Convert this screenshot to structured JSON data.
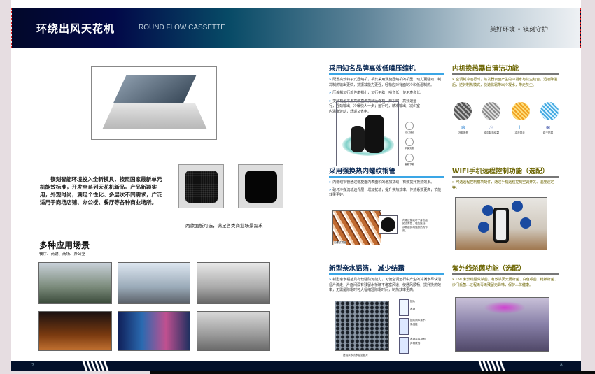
{
  "header": {
    "title": "环绕出风天花机",
    "subtitle": "ROUND FLOW CASSETTE",
    "slogan": "美好环境 • 镁刻守护"
  },
  "left": {
    "intro": "镁刻智能环境投入全新模具，按照国家最新单元机能效标准，开发全系列天花机新品。产品新颖实用，外观时尚，满足个性化、多层次不同需求，广泛适用于商场店铺、办公楼、餐厅等各种商业场所。",
    "panel_caption": "两款面板可选，满足各类商业场景需求",
    "scenes_title": "多种应用场景",
    "scenes_subtitle": "餐厅、商铺、商场、办公室",
    "page_number": "7"
  },
  "right": {
    "page_number": "8",
    "compressor": {
      "title": "采用知名品牌高效低噪压缩机",
      "p1": "配置高效转子式压缩机，相比采用涡旋压缩机的机型，动力更强劲，制冷制热输出更快，抗振减能力更强，轻松应对背面制冷和低温制热。",
      "p2": "压缩机运行部件磨损小，运行平稳，噪音低，使用寿命长。",
      "p3": "变频机型采用高效直流变频压缩机，开机时，高频速运行，强劲输出，冷暖快人一步；运行时，精准输出，减少室内温度波动，舒适又省电。",
      "icons": [
        "动力强劲",
        "平衡安静",
        "高能节能"
      ]
    },
    "copper": {
      "title": "采用强换热内螺纹铜管",
      "p1": "内螺纹铜管通过螺旋面内表面积的增加扰动，有效提升换热效果。",
      "p2": "破坏冷媒流动边界层，增加扰动，提升换热效率。传热系数更高，节能效果更好。",
      "note": "内螺纹管破坏了传热面的边界层，增加扰动，从而起到增强换热的作用。",
      "img_label": "内螺纹铜管"
    },
    "foil": {
      "title": "新型亲水铝箔， 减少结霜",
      "p1": "新型亲水铝箔具有较强防污能力，可使空调运行中产生的冷凝水尽快沿翅片流走，片面间没有残留水桥既不堵塞风道，使通风顺畅，提升换热效率，无需是除霜时可大幅缩短除霜时间，制热效率更高。",
      "img_caption": "搭载亲水防水铝箔翅片",
      "diagram": [
        "翅片",
        "水滴",
        "翅片间水珠不易结挂",
        "水滴容易凝固并易脱落"
      ]
    },
    "selfclean": {
      "title": "内机换热器自清洁功能",
      "p1": "空调制冷运行时，蒸发器表面产生的冷凝水与灰尘结合，迅速降温后，逆转制热模式，快速化霜带出冷凝水，带走灰尘。",
      "steps": [
        "冷凝吸附",
        "逆向制热化霜",
        "冲洗带走",
        "烘干防霉"
      ]
    },
    "wifi": {
      "title": "WIFI手机远程控制功能（选配）",
      "p1": "可选远程控制模块配件，通过手机远程控制空调开关、温度设定等。"
    },
    "uv": {
      "title": "紫外线杀菌功能（选配）",
      "p1": "UVC紫外线强效杀菌，有效杀灭大肠杆菌、白色喉菌、结核杆菌、沙门氏菌…过程无毒无残留无异味，保护人体健康。"
    }
  },
  "colors": {
    "title_blue": "#0b2a55",
    "title_olive": "#6b6400",
    "accent_line": "#3aa6e6",
    "footer": "#02102a",
    "header_dark": "#020848"
  }
}
